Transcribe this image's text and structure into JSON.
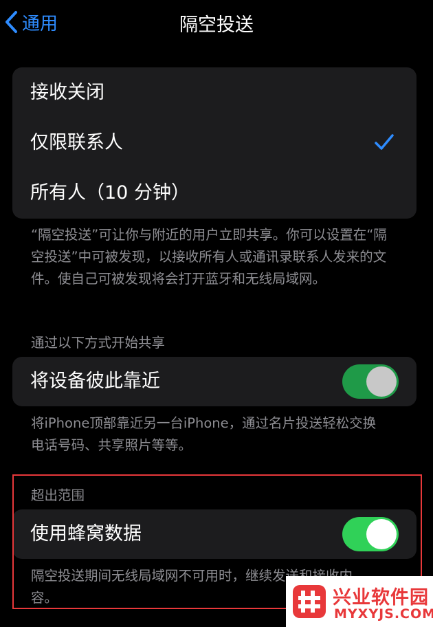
{
  "nav": {
    "back_label": "通用",
    "title": "隔空投送"
  },
  "receive": {
    "options": [
      {
        "label": "接收关闭",
        "selected": false
      },
      {
        "label": "仅限联系人",
        "selected": true
      },
      {
        "label": "所有人（10 分钟）",
        "selected": false
      }
    ],
    "footnote": "“隔空投送”可让你与附近的用户立即共享。你可以设置在“隔空投送”中可被发现，以接收所有人或通讯录联系人发来的文件。使自己可被发现将会打开蓝牙和无线局域网。"
  },
  "share": {
    "header": "通过以下方式开始共享",
    "item_label": "将设备彼此靠近",
    "toggle_on": true,
    "footnote": "将iPhone顶部靠近另一台iPhone，通过名片投送轻松交换电话号码、共享照片等等。"
  },
  "range": {
    "header": "超出范围",
    "item_label": "使用蜂窝数据",
    "toggle_on": true,
    "footnote": "隔空投送期间无线局域网不可用时，继续发送和接收内容。"
  },
  "colors": {
    "accent": "#2e8cff",
    "toggle_dim": "#1f9a48",
    "toggle_bright": "#30d158",
    "highlight": "#e8383a"
  },
  "watermark": {
    "name_cn": "兴业软件园",
    "name_en": "MYXYJS.COM"
  }
}
